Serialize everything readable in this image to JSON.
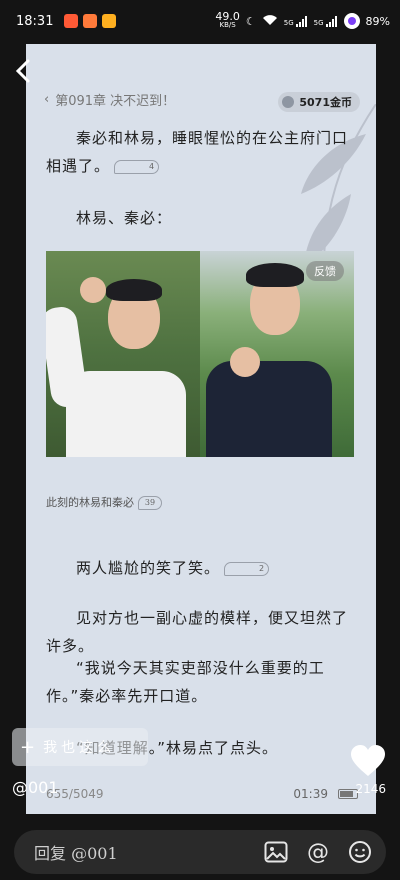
{
  "status": {
    "time": "18:31",
    "net_speed": "49.0",
    "net_unit": "KB/S",
    "battery": "89%",
    "signal_left": "5G",
    "signal_right": "5G"
  },
  "reader": {
    "chapter": "第091章 决不迟到！",
    "coins": "5071金币",
    "paragraphs": [
      {
        "text": "秦必和林易，睡眼惺忪的在公主府门口相遇了。",
        "comments": "4"
      },
      {
        "text": "林易、秦必：",
        "comments": ""
      },
      {
        "text": "两人尴尬的笑了笑。",
        "comments": "2"
      },
      {
        "text": "见对方也一副心虚的模样，便又坦然了许多。",
        "comments": ""
      },
      {
        "text": "“我说今天其实吏部没什么重要的工作。”秦必率先开口道。",
        "comments": ""
      },
      {
        "text": "“知道理解。”林易点了点头。",
        "comments": ""
      }
    ],
    "image_caption": "此刻的林易和秦必",
    "image_caption_comments": "39",
    "feedback_label": "反馈",
    "progress": "655/5049",
    "reading_time": "01:39"
  },
  "overlay": {
    "favorite_text": "我也这么",
    "mention": "@001",
    "likes": "2146"
  },
  "comment_bar": {
    "placeholder": "回复 @001"
  },
  "colors": {
    "card_bg": "#d9e0ea",
    "screen_bg": "#141414",
    "accent_purple": "#7b3ff5"
  }
}
